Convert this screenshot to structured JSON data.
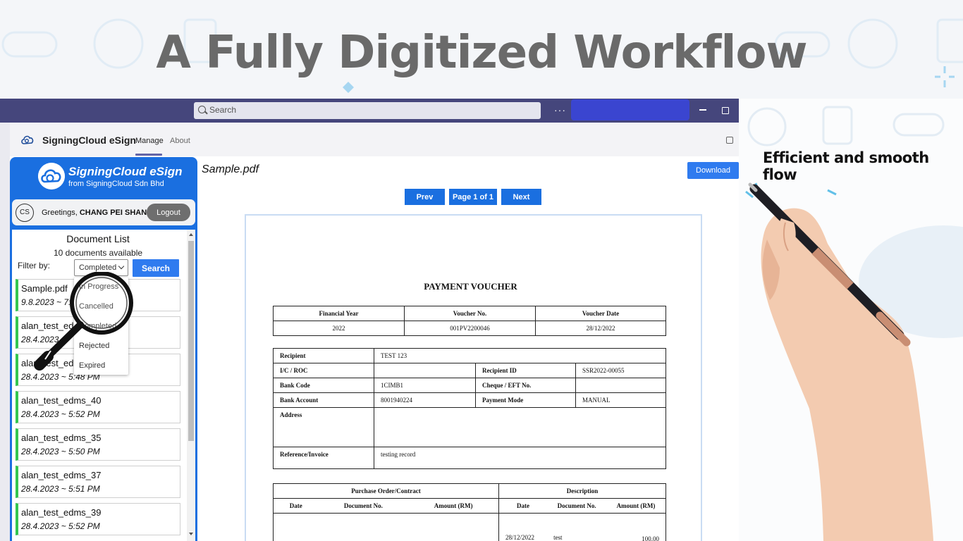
{
  "headline": "A Fully Digitized Workflow",
  "tagline": "Efficient and smooth flow",
  "window": {
    "search_placeholder": "Search",
    "more": "···"
  },
  "app": {
    "name": "SigningCloud eSign",
    "tabs": [
      "Manage",
      "About"
    ]
  },
  "sidebar": {
    "brand": "SigningCloud eSign",
    "brand_sub": "from SigningCloud Sdn Bhd",
    "avatar_initials": "CS",
    "greeting_prefix": "Greetings, ",
    "user_name": "CHANG PEI SHAN",
    "logout_label": "Logout",
    "doc_list_title": "Document List",
    "doc_count": "10 documents available",
    "filter_label": "Filter by:",
    "filter_value": "Completed",
    "search_label": "Search",
    "filter_options": [
      "In Progress",
      "Cancelled",
      "Completed",
      "Rejected",
      "Expired"
    ],
    "documents": [
      {
        "name": "Sample.pdf",
        "date": "9.8.2023 ~ 7:5"
      },
      {
        "name": "alan_test_ed",
        "date": "28.4.2023"
      },
      {
        "name": "alan_test_ed",
        "date": "28.4.2023 ~ 5:48 PM"
      },
      {
        "name": "alan_test_edms_40",
        "date": "28.4.2023 ~ 5:52 PM"
      },
      {
        "name": "alan_test_edms_35",
        "date": "28.4.2023 ~ 5:50 PM"
      },
      {
        "name": "alan_test_edms_37",
        "date": "28.4.2023 ~ 5:51 PM"
      },
      {
        "name": "alan_test_edms_39",
        "date": "28.4.2023 ~ 5:52 PM"
      }
    ]
  },
  "viewer": {
    "file_name": "Sample.pdf",
    "download_label": "Download",
    "prev_label": "Prev",
    "page_label": "Page 1 of 1",
    "next_label": "Next"
  },
  "voucher": {
    "title": "PAYMENT VOUCHER",
    "header_labels": [
      "Financial Year",
      "Voucher No.",
      "Voucher Date"
    ],
    "header_values": [
      "2022",
      "001PV2200046",
      "28/12/2022"
    ],
    "recipient_label": "Recipient",
    "recipient": "TEST 123",
    "ic_label": "I/C / ROC",
    "ic": "",
    "recipient_id_label": "Recipient ID",
    "recipient_id": "SSR2022-00055",
    "bank_code_label": "Bank Code",
    "bank_code": "1CIMB1",
    "cheque_label": "Cheque / EFT No.",
    "cheque": "",
    "bank_account_label": "Bank Account",
    "bank_account": "8001940224",
    "payment_mode_label": "Payment Mode",
    "payment_mode": "MANUAL",
    "address_label": "Address",
    "address": "",
    "reference_label": "Reference/Invoice",
    "reference": "testing record",
    "po_label": "Purchase Order/Contract",
    "desc_label": "Description",
    "col_date": "Date",
    "col_docno": "Document No.",
    "col_amount": "Amount (RM)",
    "line_date": "28/12/2022",
    "line_doc": "test",
    "line_amount": "100.00"
  }
}
